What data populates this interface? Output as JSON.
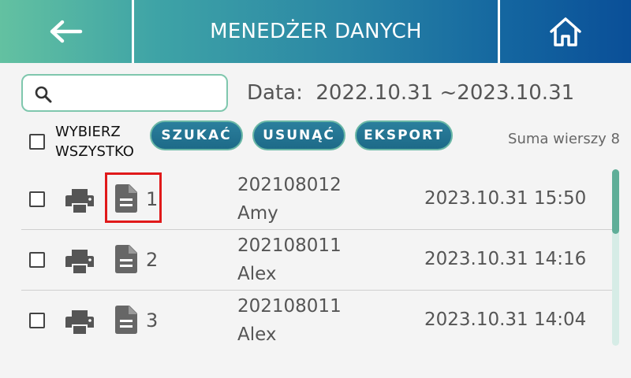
{
  "header": {
    "title": "MENEDŻER DANYCH",
    "back_icon": "arrow-left-icon",
    "home_icon": "home-icon",
    "gradient_start": "#63c1a1",
    "gradient_end": "#0a4f98"
  },
  "search": {
    "placeholder": "",
    "value": "",
    "icon": "search-icon"
  },
  "date_range": {
    "text": "Data:  2022.10.31 ~2023.10.31"
  },
  "toolbar": {
    "select_all_line1": "WYBIERZ",
    "select_all_line2": "WSZYSTKO",
    "search_label": "SZUKAĆ",
    "delete_label": "USUNĄĆ",
    "export_label": "EKSPORT",
    "row_count": "Suma wierszy 8"
  },
  "rows": [
    {
      "index": "1",
      "id": "202108012",
      "name": "Amy",
      "datetime": "2023.10.31 15:50",
      "highlighted": true
    },
    {
      "index": "2",
      "id": "202108011",
      "name": "Alex",
      "datetime": "2023.10.31 14:16"
    },
    {
      "index": "3",
      "id": "202108011",
      "name": "Alex",
      "datetime": "2023.10.31 14:04"
    }
  ],
  "colors": {
    "button": "#1d6a88",
    "highlight": "#e0191a",
    "scrollbar": "#5fae98"
  }
}
